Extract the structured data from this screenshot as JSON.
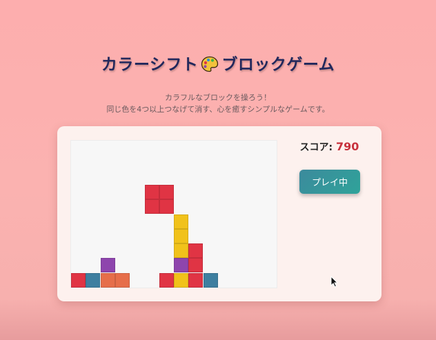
{
  "title_part1": "カラーシフト",
  "title_part2": "ブロックゲーム",
  "title_icon": "palette-icon",
  "subtitle_line1": "カラフルなブロックを操ろう！",
  "subtitle_line2": "同じ色を4つ以上つなげて消す、心を癒すシンプルなゲームです。",
  "score": {
    "label": "スコア: ",
    "value": "790"
  },
  "play_button": "プレイ中",
  "colors": {
    "red": "#e03444",
    "blue": "#3e7fa0",
    "purple": "#8e45ad",
    "orange": "#e66e4a",
    "yellow": "#f1c21b"
  },
  "board": {
    "rows": 10,
    "cols": 14,
    "blocks": [
      {
        "row": 3,
        "col": 5,
        "color": "red"
      },
      {
        "row": 3,
        "col": 6,
        "color": "red"
      },
      {
        "row": 4,
        "col": 5,
        "color": "red"
      },
      {
        "row": 4,
        "col": 6,
        "color": "red"
      },
      {
        "row": 5,
        "col": 7,
        "color": "yellow"
      },
      {
        "row": 6,
        "col": 7,
        "color": "yellow"
      },
      {
        "row": 7,
        "col": 7,
        "color": "yellow"
      },
      {
        "row": 7,
        "col": 8,
        "color": "red"
      },
      {
        "row": 8,
        "col": 2,
        "color": "purple"
      },
      {
        "row": 8,
        "col": 7,
        "color": "purple"
      },
      {
        "row": 8,
        "col": 8,
        "color": "red"
      },
      {
        "row": 9,
        "col": 0,
        "color": "red"
      },
      {
        "row": 9,
        "col": 1,
        "color": "blue"
      },
      {
        "row": 9,
        "col": 2,
        "color": "orange"
      },
      {
        "row": 9,
        "col": 3,
        "color": "orange"
      },
      {
        "row": 9,
        "col": 6,
        "color": "red"
      },
      {
        "row": 9,
        "col": 7,
        "color": "yellow"
      },
      {
        "row": 9,
        "col": 8,
        "color": "red"
      },
      {
        "row": 9,
        "col": 9,
        "color": "blue"
      }
    ]
  }
}
